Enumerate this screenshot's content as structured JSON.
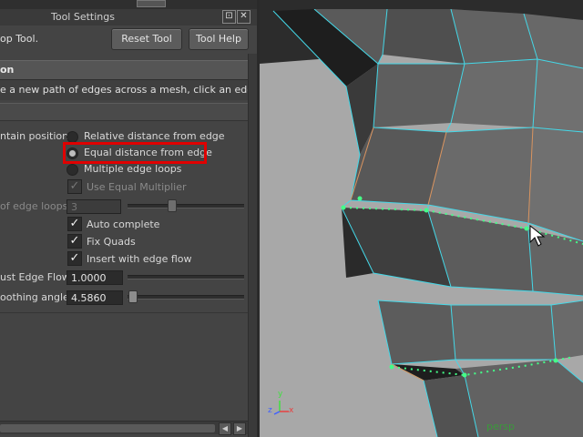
{
  "window": {
    "title": "Tool Settings",
    "float_glyph": "⊡",
    "close_glyph": "✕"
  },
  "tool": {
    "name": "op Tool.",
    "reset_label": "Reset Tool",
    "help_label": "Tool Help"
  },
  "section": {
    "title": "on"
  },
  "description": "e a new path of edges across a mesh, click an edge and c",
  "maintain": {
    "label": "ntain position:",
    "options": [
      "Relative distance from edge",
      "Equal distance from edge",
      "Multiple edge loops"
    ],
    "selected_index": 1
  },
  "use_equal_multiplier": {
    "label": "Use Equal Multiplier",
    "checked": true,
    "enabled": false
  },
  "edge_loops": {
    "label": "of edge loops:",
    "value": "3"
  },
  "auto_complete": {
    "label": "Auto complete",
    "checked": true
  },
  "fix_quads": {
    "label": "Fix Quads",
    "checked": true
  },
  "insert_edge_flow": {
    "label": "Insert with edge flow",
    "checked": true
  },
  "adjust_edge_flow": {
    "label": "ust Edge Flow",
    "value": "1.0000"
  },
  "smoothing": {
    "label": "oothing angle:",
    "value": "4.5860"
  },
  "check_glyph": "✓",
  "viewport": {
    "camera_label": "persp",
    "axis": {
      "y": "y",
      "x": "x",
      "z": "z"
    },
    "colors": {
      "wire": "#44d8e8",
      "edge_guide": "#44ff88",
      "edge_flow": "#d89460",
      "axis_x": "#e84040",
      "axis_y": "#40e040",
      "axis_z": "#4060ff",
      "camera_label": "#3a9a3a"
    }
  },
  "scroll": {
    "left_glyph": "◀",
    "right_glyph": "▶"
  }
}
